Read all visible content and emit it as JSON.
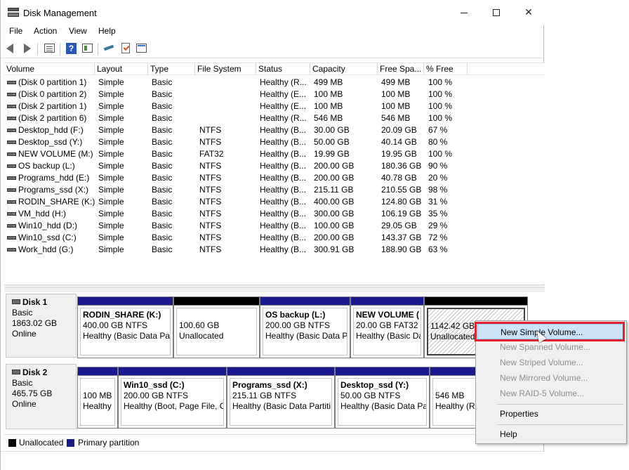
{
  "window": {
    "title": "Disk Management"
  },
  "menu": [
    "File",
    "Action",
    "View",
    "Help"
  ],
  "toolbar": {
    "icons": [
      "back-arrow-icon",
      "forward-arrow-icon",
      "console-tree-icon",
      "help-icon",
      "properties-icon",
      "connect-icon",
      "check-icon",
      "window-icon"
    ]
  },
  "columns": [
    "Volume",
    "Layout",
    "Type",
    "File System",
    "Status",
    "Capacity",
    "Free Spa...",
    "% Free"
  ],
  "volumes": [
    [
      "(Disk 0 partition 1)",
      "Simple",
      "Basic",
      "",
      "Healthy (R...",
      "499 MB",
      "499 MB",
      "100 %"
    ],
    [
      "(Disk 0 partition 2)",
      "Simple",
      "Basic",
      "",
      "Healthy (E...",
      "100 MB",
      "100 MB",
      "100 %"
    ],
    [
      "(Disk 2 partition 1)",
      "Simple",
      "Basic",
      "",
      "Healthy (E...",
      "100 MB",
      "100 MB",
      "100 %"
    ],
    [
      "(Disk 2 partition 6)",
      "Simple",
      "Basic",
      "",
      "Healthy (R...",
      "546 MB",
      "546 MB",
      "100 %"
    ],
    [
      "Desktop_hdd (F:)",
      "Simple",
      "Basic",
      "NTFS",
      "Healthy (B...",
      "30.00 GB",
      "20.09 GB",
      "67 %"
    ],
    [
      "Desktop_ssd (Y:)",
      "Simple",
      "Basic",
      "NTFS",
      "Healthy (B...",
      "50.00 GB",
      "40.14 GB",
      "80 %"
    ],
    [
      "NEW VOLUME (M:)",
      "Simple",
      "Basic",
      "FAT32",
      "Healthy (B...",
      "19.99 GB",
      "19.95 GB",
      "100 %"
    ],
    [
      "OS backup (L:)",
      "Simple",
      "Basic",
      "NTFS",
      "Healthy (B...",
      "200.00 GB",
      "180.36 GB",
      "90 %"
    ],
    [
      "Programs_hdd (E:)",
      "Simple",
      "Basic",
      "NTFS",
      "Healthy (B...",
      "200.00 GB",
      "40.78 GB",
      "20 %"
    ],
    [
      "Programs_ssd (X:)",
      "Simple",
      "Basic",
      "NTFS",
      "Healthy (B...",
      "215.11 GB",
      "210.55 GB",
      "98 %"
    ],
    [
      "RODIN_SHARE (K:)",
      "Simple",
      "Basic",
      "NTFS",
      "Healthy (B...",
      "400.00 GB",
      "124.80 GB",
      "31 %"
    ],
    [
      "VM_hdd (H:)",
      "Simple",
      "Basic",
      "NTFS",
      "Healthy (B...",
      "300.00 GB",
      "106.19 GB",
      "35 %"
    ],
    [
      "Win10_hdd (D:)",
      "Simple",
      "Basic",
      "NTFS",
      "Healthy (B...",
      "100.00 GB",
      "29.05 GB",
      "29 %"
    ],
    [
      "Win10_ssd (C:)",
      "Simple",
      "Basic",
      "NTFS",
      "Healthy (B...",
      "200.00 GB",
      "143.37 GB",
      "72 %"
    ],
    [
      "Work_hdd (G:)",
      "Simple",
      "Basic",
      "NTFS",
      "Healthy (B...",
      "300.91 GB",
      "188.90 GB",
      "63 %"
    ]
  ],
  "disks": [
    {
      "name": "Disk 1",
      "type": "Basic",
      "size": "1863.02 GB",
      "state": "Online",
      "partitions": [
        {
          "name": "RODIN_SHARE  (K:)",
          "line1": "400.00 GB NTFS",
          "line2": "Healthy (Basic Data Par",
          "kind": "primary"
        },
        {
          "name": "",
          "line1": "100.60 GB",
          "line2": "Unallocated",
          "kind": "unalloc"
        },
        {
          "name": "OS backup  (L:)",
          "line1": "200.00 GB NTFS",
          "line2": "Healthy (Basic Data P",
          "kind": "primary"
        },
        {
          "name": "NEW VOLUME  (",
          "line1": "20.00 GB FAT32",
          "line2": "Healthy (Basic Da",
          "kind": "primary"
        },
        {
          "name": "",
          "line1": "1142.42 GB",
          "line2": "Unallocated",
          "kind": "unalloc-selected"
        }
      ]
    },
    {
      "name": "Disk 2",
      "type": "Basic",
      "size": "465.75 GB",
      "state": "Online",
      "partitions": [
        {
          "name": "",
          "line1": "100 MB",
          "line2": "Healthy",
          "kind": "primary"
        },
        {
          "name": "Win10_ssd  (C:)",
          "line1": "200.00 GB NTFS",
          "line2": "Healthy (Boot, Page File, C",
          "kind": "primary"
        },
        {
          "name": "Programs_ssd  (X:)",
          "line1": "215.11 GB NTFS",
          "line2": "Healthy (Basic Data Partiti",
          "kind": "primary"
        },
        {
          "name": "Desktop_ssd  (Y:)",
          "line1": "50.00 GB NTFS",
          "line2": "Healthy (Basic Data Pa",
          "kind": "primary"
        },
        {
          "name": "",
          "line1": "546 MB",
          "line2": "Healthy (Re",
          "kind": "primary"
        }
      ]
    }
  ],
  "legend": {
    "unallocated": "Unallocated",
    "primary": "Primary partition"
  },
  "context_menu": {
    "items": [
      {
        "label": "New Simple Volume...",
        "enabled": true,
        "active": true
      },
      {
        "label": "New Spanned Volume...",
        "enabled": false
      },
      {
        "label": "New Striped Volume...",
        "enabled": false
      },
      {
        "label": "New Mirrored Volume...",
        "enabled": false
      },
      {
        "label": "New RAID-5 Volume...",
        "enabled": false
      },
      {
        "label": "Properties",
        "enabled": true
      },
      {
        "label": "Help",
        "enabled": true
      }
    ]
  },
  "colors": {
    "primary": "#1a1a8e",
    "unallocated": "#000000",
    "highlight": "#e0202a",
    "menu_hover": "#cce4f7"
  }
}
